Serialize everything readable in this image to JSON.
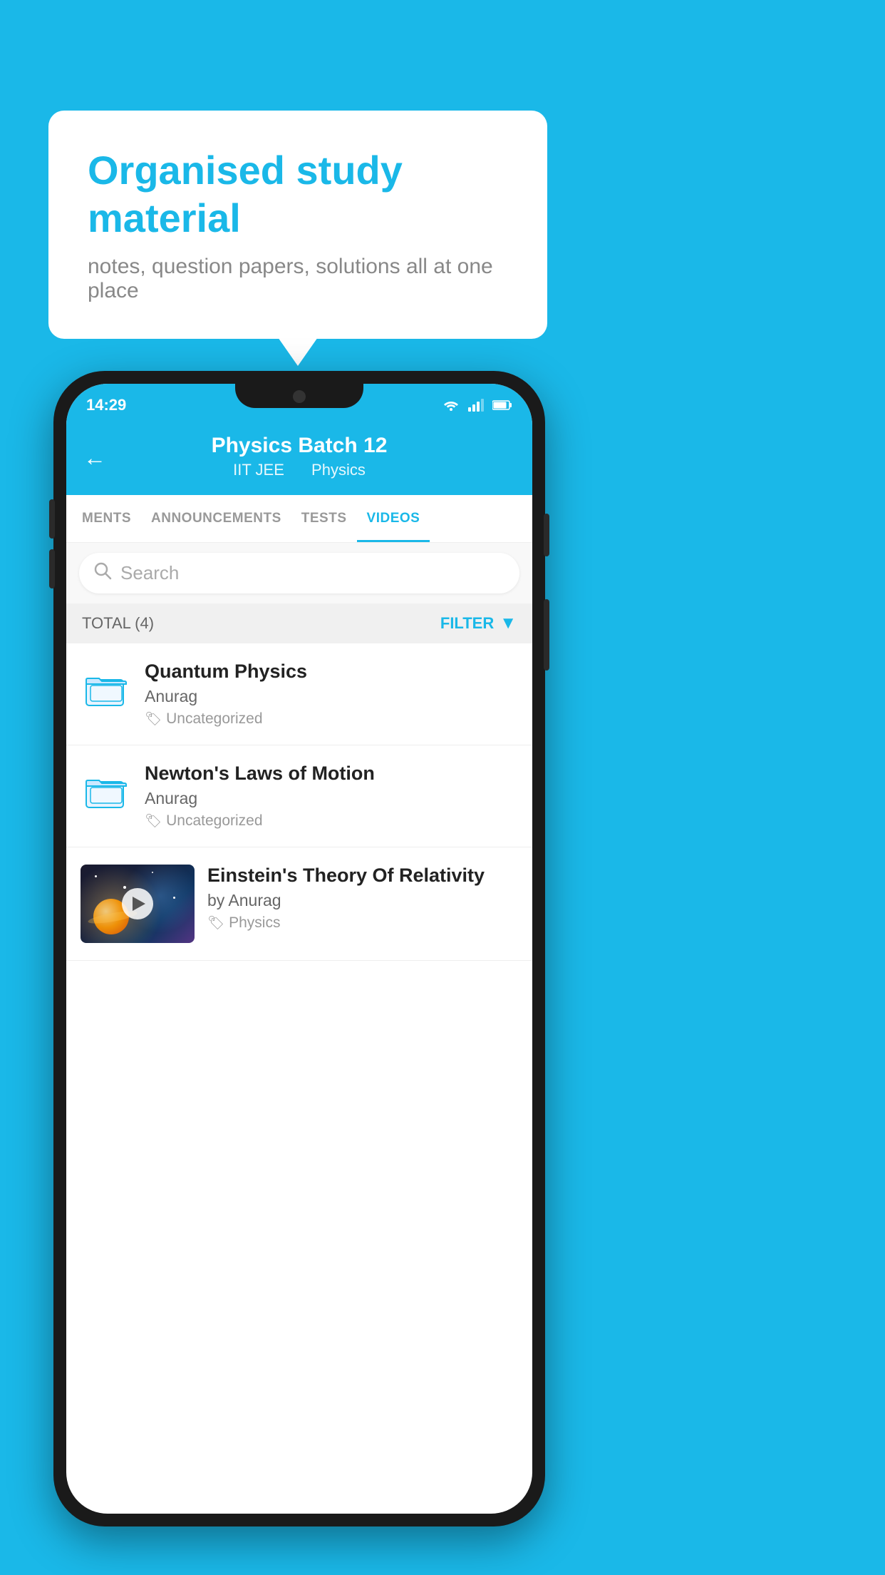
{
  "background": {
    "color": "#1ab8e8"
  },
  "speech_bubble": {
    "title": "Organised study material",
    "subtitle": "notes, question papers, solutions all at one place"
  },
  "status_bar": {
    "time": "14:29"
  },
  "header": {
    "title": "Physics Batch 12",
    "subtitle_part1": "IIT JEE",
    "subtitle_part2": "Physics",
    "back_label": "←"
  },
  "tabs": [
    {
      "label": "MENTS",
      "active": false
    },
    {
      "label": "ANNOUNCEMENTS",
      "active": false
    },
    {
      "label": "TESTS",
      "active": false
    },
    {
      "label": "VIDEOS",
      "active": true
    }
  ],
  "search": {
    "placeholder": "Search"
  },
  "filter_bar": {
    "total_label": "TOTAL (4)",
    "filter_label": "FILTER"
  },
  "videos": [
    {
      "id": 1,
      "title": "Quantum Physics",
      "author": "Anurag",
      "tag": "Uncategorized",
      "has_thumbnail": false
    },
    {
      "id": 2,
      "title": "Newton's Laws of Motion",
      "author": "Anurag",
      "tag": "Uncategorized",
      "has_thumbnail": false
    },
    {
      "id": 3,
      "title": "Einstein's Theory Of Relativity",
      "author": "by Anurag",
      "tag": "Physics",
      "has_thumbnail": true
    }
  ]
}
